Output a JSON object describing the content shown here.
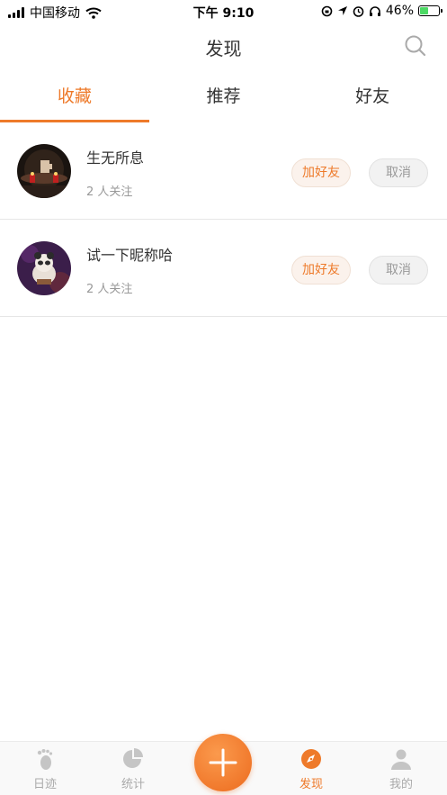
{
  "status_bar": {
    "carrier": "中国移动",
    "time": "下午 9:10",
    "battery_percent": "46%",
    "battery_level": 0.46,
    "icons": [
      "signal-icon",
      "wifi-icon",
      "lock-rotation-icon",
      "location-icon",
      "alarm-icon",
      "headphones-icon",
      "battery-icon"
    ]
  },
  "nav": {
    "title": "发现",
    "search_icon": "search-icon"
  },
  "tabs": [
    {
      "label": "收藏",
      "active": true
    },
    {
      "label": "推荐",
      "active": false
    },
    {
      "label": "好友",
      "active": false
    }
  ],
  "list": [
    {
      "name": "生无所息",
      "followers": "2 人关注",
      "add_label": "加好友",
      "cancel_label": "取消"
    },
    {
      "name": "试一下昵称哈",
      "followers": "2 人关注",
      "add_label": "加好友",
      "cancel_label": "取消"
    }
  ],
  "tabbar": {
    "items": [
      {
        "label": "日迹",
        "icon": "footprint-icon",
        "active": false
      },
      {
        "label": "统计",
        "icon": "pie-chart-icon",
        "active": false
      },
      {
        "label": "发现",
        "icon": "compass-icon",
        "active": true
      },
      {
        "label": "我的",
        "icon": "person-icon",
        "active": false
      }
    ],
    "add_icon": "plus-icon"
  },
  "colors": {
    "accent": "#ee7a2a",
    "muted": "#999999",
    "divider": "#e6e6e6"
  }
}
